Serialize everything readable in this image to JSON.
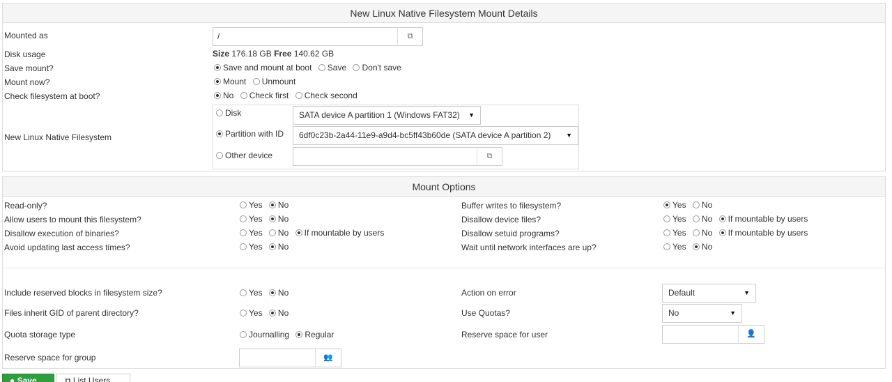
{
  "details": {
    "title": "New Linux Native Filesystem Mount Details",
    "mounted_as_label": "Mounted as",
    "mounted_as_value": "/",
    "disk_usage_label": "Disk usage",
    "size_label": "Size",
    "size_value": "176.18 GB",
    "free_label": "Free",
    "free_value": "140.62 GB",
    "save_mount_label": "Save mount?",
    "save_mount_options": [
      "Save and mount at boot",
      "Save",
      "Don't save"
    ],
    "mount_now_label": "Mount now?",
    "mount_now_options": [
      "Mount",
      "Unmount"
    ],
    "check_fs_label": "Check filesystem at boot?",
    "check_fs_options": [
      "No",
      "Check first",
      "Check second"
    ],
    "device_label": "New Linux Native Filesystem",
    "disk_option": "Disk",
    "disk_value": "SATA device A partition 1 (Windows FAT32)",
    "partition_option": "Partition with ID",
    "partition_value": "6df0c23b-2a44-11e9-a9d4-bc5ff43b60de (SATA device A partition 2)",
    "other_option": "Other device",
    "other_value": ""
  },
  "options": {
    "title": "Mount Options",
    "read_only_label": "Read-only?",
    "allow_users_label": "Allow users to mount this filesystem?",
    "disallow_exec_label": "Disallow execution of binaries?",
    "avoid_atime_label": "Avoid updating last access times?",
    "buffer_writes_label": "Buffer writes to filesystem?",
    "disallow_device_label": "Disallow device files?",
    "disallow_setuid_label": "Disallow setuid programs?",
    "wait_network_label": "Wait until network interfaces are up?",
    "yes": "Yes",
    "no": "No",
    "if_mountable": "If mountable by users",
    "reserved_blocks_label": "Include reserved blocks in filesystem size?",
    "inherit_gid_label": "Files inherit GID of parent directory?",
    "quota_type_label": "Quota storage type",
    "journalling": "Journalling",
    "regular": "Regular",
    "reserve_group_label": "Reserve space for group",
    "action_error_label": "Action on error",
    "action_error_value": "Default",
    "use_quotas_label": "Use Quotas?",
    "use_quotas_value": "No",
    "reserve_user_label": "Reserve space for user"
  },
  "buttons": {
    "save": "Save",
    "list": "List Users"
  }
}
